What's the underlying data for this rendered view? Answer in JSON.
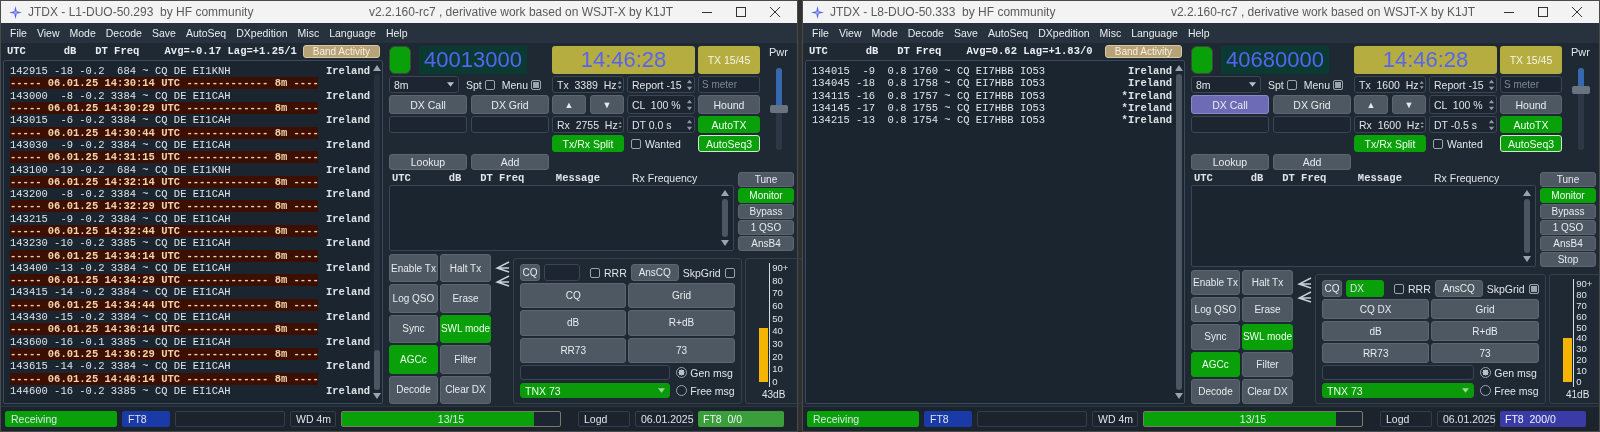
{
  "windows": [
    {
      "title": "JTDX - L1-DUO-50.293  by HF community",
      "version": "v2.2.160-rc7 , derivative work based on WSJT-X by K1JT",
      "menu": [
        "File",
        "View",
        "Mode",
        "Decode",
        "Save",
        "AutoSeq",
        "DXpedition",
        "Misc",
        "Language",
        "Help"
      ],
      "band_activity": {
        "header": "UTC      dB   DT Freq    Avg=-0.17 Lag=+1.25/1",
        "button": "Band Activity",
        "lines": [
          {
            "kind": "decode",
            "text": "142915 -18 -0.2  684 ~ CQ DE EI1KNH",
            "country": "Ireland"
          },
          {
            "kind": "separator",
            "text": "----- 06.01.25 14:30:14 UTC ------------- 8m ----"
          },
          {
            "kind": "decode",
            "text": "143000  -8 -0.2 3384 ~ CQ DE EI1CAH",
            "country": "Ireland"
          },
          {
            "kind": "separator",
            "text": "----- 06.01.25 14:30:29 UTC ------------- 8m ----"
          },
          {
            "kind": "decode",
            "text": "143015  -6 -0.2 3384 ~ CQ DE EI1CAH",
            "country": "Ireland"
          },
          {
            "kind": "separator",
            "text": "----- 06.01.25 14:30:44 UTC ------------- 8m ----"
          },
          {
            "kind": "decode",
            "text": "143030  -9 -0.2 3384 ~ CQ DE EI1CAH",
            "country": "Ireland"
          },
          {
            "kind": "separator",
            "text": "----- 06.01.25 14:31:15 UTC ------------- 8m ----"
          },
          {
            "kind": "decode",
            "text": "143100 -19 -0.2  684 ~ CQ DE EI1KNH",
            "country": "Ireland"
          },
          {
            "kind": "separator",
            "text": "----- 06.01.25 14:32:14 UTC ------------- 8m ----"
          },
          {
            "kind": "decode",
            "text": "143200  -8 -0.2 3384 ~ CQ DE EI1CAH",
            "country": "Ireland"
          },
          {
            "kind": "separator",
            "text": "----- 06.01.25 14:32:29 UTC ------------- 8m ----"
          },
          {
            "kind": "decode",
            "text": "143215  -9 -0.2 3384 ~ CQ DE EI1CAH",
            "country": "Ireland"
          },
          {
            "kind": "separator",
            "text": "----- 06.01.25 14:32:44 UTC ------------- 8m ----"
          },
          {
            "kind": "decode",
            "text": "143230 -10 -0.2 3385 ~ CQ DE EI1CAH",
            "country": "Ireland"
          },
          {
            "kind": "separator",
            "text": "----- 06.01.25 14:34:14 UTC ------------- 8m ----"
          },
          {
            "kind": "decode",
            "text": "143400 -13 -0.2 3384 ~ CQ DE EI1CAH",
            "country": "Ireland"
          },
          {
            "kind": "separator",
            "text": "----- 06.01.25 14:34:29 UTC ------------- 8m ----"
          },
          {
            "kind": "decode",
            "text": "143415 -14 -0.2 3384 ~ CQ DE EI1CAH",
            "country": "Ireland"
          },
          {
            "kind": "separator",
            "text": "----- 06.01.25 14:34:44 UTC ------------- 8m ----"
          },
          {
            "kind": "decode",
            "text": "143430 -15 -0.2 3384 ~ CQ DE EI1CAH",
            "country": "Ireland"
          },
          {
            "kind": "separator",
            "text": "----- 06.01.25 14:36:14 UTC ------------- 8m ----"
          },
          {
            "kind": "decode",
            "text": "143600 -16 -0.1 3385 ~ CQ DE EI1CAH",
            "country": "Ireland"
          },
          {
            "kind": "separator",
            "text": "----- 06.01.25 14:36:29 UTC ------------- 8m ----"
          },
          {
            "kind": "decode",
            "text": "143615 -14 -0.2 3384 ~ CQ DE EI1CAH",
            "country": "Ireland"
          },
          {
            "kind": "separator",
            "text": "----- 06.01.25 14:46:14 UTC ------------- 8m ----"
          },
          {
            "kind": "decode",
            "text": "144600 -16 -0.2 3385 ~ CQ DE EI1CAH",
            "country": "Ireland"
          }
        ]
      },
      "controls": {
        "frequency": "40013000",
        "clock": "14:46:28",
        "tx_period": "TX 15/45",
        "power": {
          "label": "Pwr",
          "level": 0.5
        },
        "band": "8m",
        "spot": {
          "label": "Spt",
          "checked": false
        },
        "menu_toggle": {
          "label": "Menu",
          "checked": true
        },
        "tx_freq": "Tx  3389  Hz",
        "report": "Report -15",
        "s_meter": {
          "placeholder": "S meter"
        },
        "up": "▲",
        "down": "▼",
        "cl": "CL  100 %",
        "rx_freq": "Rx  2755  Hz",
        "dt": "DT 0.0 s",
        "hound": {
          "label": "Hound",
          "on": false
        },
        "autotx": {
          "label": "AutoTX",
          "on": true
        },
        "split": {
          "label": "Tx/Rx Split",
          "on": true
        },
        "wanted": {
          "label": "Wanted",
          "checked": false
        },
        "autoseq": {
          "label": "AutoSeq3",
          "on": true
        },
        "dx_call": {
          "label": "DX Call",
          "selected": false
        },
        "dx_grid": "DX Grid",
        "lookup": "Lookup",
        "add": "Add",
        "rx_header": {
          "columns": "UTC      dB   DT Freq     Message",
          "rx_frequency": "Rx Frequency"
        },
        "side_buttons": [
          {
            "label": "Tune",
            "on": false
          },
          {
            "label": "Monitor",
            "on": true
          },
          {
            "label": "Bypass",
            "on": false
          },
          {
            "label": "1 QSO",
            "on": false
          },
          {
            "label": "AnsB4",
            "on": false
          }
        ],
        "action_buttons": [
          {
            "label": "Enable Tx",
            "on": false
          },
          {
            "label": "Halt Tx",
            "on": false
          },
          {
            "label": "Log QSO",
            "on": false
          },
          {
            "label": "Erase",
            "on": false
          },
          {
            "label": "Sync",
            "on": false
          },
          {
            "label": "SWL mode",
            "on": true
          },
          {
            "label": "AGCc",
            "on": true
          },
          {
            "label": "Filter",
            "on": false
          },
          {
            "label": "Decode",
            "on": false
          },
          {
            "label": "Clear DX",
            "on": false
          }
        ],
        "messages": {
          "cq": "CQ",
          "dx_field": {
            "highlighted": false
          },
          "rrr": {
            "label": "RRR",
            "checked": false
          },
          "anscq": "AnsCQ",
          "skpgrid": {
            "label": "SkpGrid",
            "checked": false
          },
          "buttons": [
            "CQ",
            "Grid",
            "dB",
            "R+dB",
            "RR73",
            "73"
          ],
          "free_text": "TNX 73",
          "radios": [
            {
              "label": "Gen msg",
              "selected": true
            },
            {
              "label": "Free msg",
              "selected": false
            }
          ]
        },
        "meter": {
          "scale": [
            "90+",
            "80",
            "70",
            "60",
            "50",
            "40",
            "30",
            "20",
            "10",
            "0"
          ],
          "level": 0.47,
          "reading": "43dB"
        }
      },
      "status_bar": {
        "state": "Receiving",
        "mode": "FT8",
        "watchdog": "WD 4m",
        "progress": {
          "text": "13/15",
          "level": 0.88
        },
        "log": "Logd",
        "date": "06.01.2025",
        "decodes": {
          "text": "FT8  0/0",
          "color": "#3a9e3a"
        }
      }
    },
    {
      "title": "JTDX - L8-DUO-50.333  by HF community",
      "version": "v2.2.160-rc7 , derivative work based on WSJT-X by K1JT",
      "menu": [
        "File",
        "View",
        "Mode",
        "Decode",
        "Save",
        "AutoSeq",
        "DXpedition",
        "Misc",
        "Language",
        "Help"
      ],
      "band_activity": {
        "header": "UTC      dB   DT Freq    Avg=0.62 Lag=+1.83/0",
        "button": "Band Activity",
        "lines": [
          {
            "kind": "decode",
            "text": "134015  -9  0.8 1760 ~ CQ EI7HBB IO53",
            "country": "Ireland"
          },
          {
            "kind": "decode",
            "text": "134045 -18  0.8 1758 ~ CQ EI7HBB IO53",
            "country": "Ireland"
          },
          {
            "kind": "decode",
            "text": "134115 -16  0.8 1757 ~ CQ EI7HBB IO53",
            "country": "*Ireland"
          },
          {
            "kind": "decode",
            "text": "134145 -17  0.8 1755 ~ CQ EI7HBB IO53",
            "country": "*Ireland"
          },
          {
            "kind": "decode",
            "text": "134215 -13  0.8 1754 ~ CQ EI7HBB IO53",
            "country": "*Ireland"
          }
        ]
      },
      "controls": {
        "frequency": "40680000",
        "clock": "14:46:28",
        "tx_period": "TX 15/45",
        "power": {
          "label": "Pwr",
          "level": 0.73
        },
        "band": "8m",
        "spot": {
          "label": "Spt",
          "checked": false
        },
        "menu_toggle": {
          "label": "Menu",
          "checked": true
        },
        "tx_freq": "Tx  1600  Hz",
        "report": "Report -15",
        "s_meter": {
          "placeholder": "S meter"
        },
        "up": "▲",
        "down": "▼",
        "cl": "CL  100 %",
        "rx_freq": "Rx  1600  Hz",
        "dt": "DT -0.5 s",
        "hound": {
          "label": "Hound",
          "on": false
        },
        "autotx": {
          "label": "AutoTX",
          "on": true
        },
        "split": {
          "label": "Tx/Rx Split",
          "on": true
        },
        "wanted": {
          "label": "Wanted",
          "checked": false
        },
        "autoseq": {
          "label": "AutoSeq3",
          "on": true
        },
        "dx_call": {
          "label": "DX Call",
          "selected": true
        },
        "dx_grid": "DX Grid",
        "lookup": "Lookup",
        "add": "Add",
        "rx_header": {
          "columns": "UTC      dB   DT Freq     Message",
          "rx_frequency": "Rx Frequency"
        },
        "side_buttons": [
          {
            "label": "Tune",
            "on": false
          },
          {
            "label": "Monitor",
            "on": true
          },
          {
            "label": "Bypass",
            "on": false
          },
          {
            "label": "1 QSO",
            "on": false
          },
          {
            "label": "AnsB4",
            "on": false
          },
          {
            "label": "Stop",
            "on": false
          }
        ],
        "action_buttons": [
          {
            "label": "Enable Tx",
            "on": false
          },
          {
            "label": "Halt Tx",
            "on": false
          },
          {
            "label": "Log QSO",
            "on": false
          },
          {
            "label": "Erase",
            "on": false
          },
          {
            "label": "Sync",
            "on": false
          },
          {
            "label": "SWL mode",
            "on": true
          },
          {
            "label": "AGCc",
            "on": true
          },
          {
            "label": "Filter",
            "on": false
          },
          {
            "label": "Decode",
            "on": false
          },
          {
            "label": "Clear DX",
            "on": false
          }
        ],
        "messages": {
          "cq": "CQ",
          "dx_field": {
            "value": "DX",
            "highlighted": true
          },
          "rrr": {
            "label": "RRR",
            "checked": false
          },
          "anscq": "AnsCQ",
          "skpgrid": {
            "label": "SkpGrid",
            "checked": true
          },
          "buttons": [
            "CQ DX",
            "Grid",
            "dB",
            "R+dB",
            "RR73",
            "73"
          ],
          "free_text": "TNX 73",
          "radios": [
            {
              "label": "Gen msg",
              "selected": true
            },
            {
              "label": "Free msg",
              "selected": false
            }
          ]
        },
        "meter": {
          "scale": [
            "90+",
            "80",
            "70",
            "60",
            "50",
            "40",
            "30",
            "20",
            "10",
            "0"
          ],
          "level": 0.45,
          "reading": "41dB"
        }
      },
      "status_bar": {
        "state": "Receiving",
        "mode": "FT8",
        "watchdog": "WD 4m",
        "progress": {
          "text": "13/15",
          "level": 0.88
        },
        "log": "Logd",
        "date": "06.01.2025",
        "decodes": {
          "text": "FT8  200/0",
          "color": "#3b3ba8"
        }
      }
    }
  ]
}
